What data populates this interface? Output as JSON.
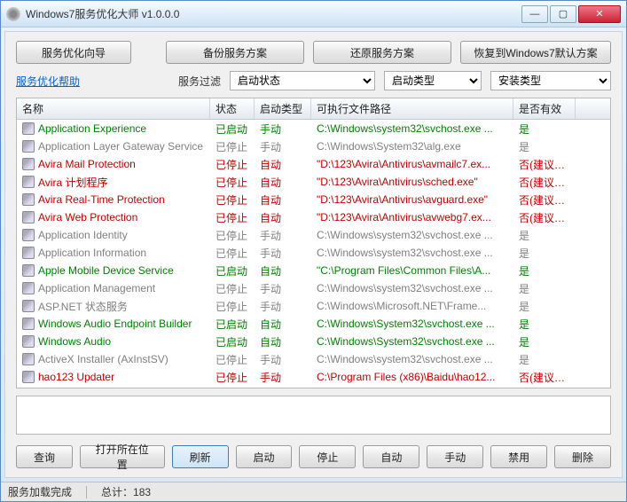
{
  "title": "Windows7服务优化大师 v1.0.0.0",
  "topButtons": {
    "wizard": "服务优化向导",
    "backup": "备份服务方案",
    "restore": "还原服务方案",
    "resetDefault": "恢复到Windows7默认方案"
  },
  "helpLink": "服务优化帮助",
  "filterLabel": "服务过滤",
  "filters": {
    "state": {
      "selected": "启动状态",
      "options": [
        "启动状态"
      ]
    },
    "startType": {
      "selected": "启动类型",
      "options": [
        "启动类型"
      ]
    },
    "installType": {
      "selected": "安装类型",
      "options": [
        "安装类型"
      ]
    }
  },
  "columns": {
    "name": "名称",
    "state": "状态",
    "startType": "启动类型",
    "path": "可执行文件路径",
    "valid": "是否有效"
  },
  "rows": [
    {
      "name": "Application Experience",
      "state": "已启动",
      "start": "手动",
      "path": "C:\\Windows\\system32\\svchost.exe ...",
      "valid": "是",
      "color": "green"
    },
    {
      "name": "Application Layer Gateway Service",
      "state": "已停止",
      "start": "手动",
      "path": "C:\\Windows\\System32\\alg.exe",
      "valid": "是",
      "color": "gray"
    },
    {
      "name": "Avira Mail Protection",
      "state": "已停止",
      "start": "自动",
      "path": "\"D:\\123\\Avira\\Antivirus\\avmailc7.ex...",
      "valid": "否(建议删...",
      "color": "red"
    },
    {
      "name": "Avira 计划程序",
      "state": "已停止",
      "start": "自动",
      "path": "\"D:\\123\\Avira\\Antivirus\\sched.exe\"",
      "valid": "否(建议删...",
      "color": "red"
    },
    {
      "name": "Avira Real-Time Protection",
      "state": "已停止",
      "start": "自动",
      "path": "\"D:\\123\\Avira\\Antivirus\\avguard.exe\"",
      "valid": "否(建议删...",
      "color": "red"
    },
    {
      "name": "Avira Web Protection",
      "state": "已停止",
      "start": "自动",
      "path": "\"D:\\123\\Avira\\Antivirus\\avwebg7.ex...",
      "valid": "否(建议删...",
      "color": "red"
    },
    {
      "name": "Application Identity",
      "state": "已停止",
      "start": "手动",
      "path": "C:\\Windows\\system32\\svchost.exe ...",
      "valid": "是",
      "color": "gray"
    },
    {
      "name": "Application Information",
      "state": "已停止",
      "start": "手动",
      "path": "C:\\Windows\\system32\\svchost.exe ...",
      "valid": "是",
      "color": "gray"
    },
    {
      "name": "Apple Mobile Device Service",
      "state": "已启动",
      "start": "自动",
      "path": "\"C:\\Program Files\\Common Files\\A...",
      "valid": "是",
      "color": "green"
    },
    {
      "name": "Application Management",
      "state": "已停止",
      "start": "手动",
      "path": "C:\\Windows\\system32\\svchost.exe ...",
      "valid": "是",
      "color": "gray"
    },
    {
      "name": "ASP.NET 状态服务",
      "state": "已停止",
      "start": "手动",
      "path": "C:\\Windows\\Microsoft.NET\\Frame...",
      "valid": "是",
      "color": "gray"
    },
    {
      "name": "Windows Audio Endpoint Builder",
      "state": "已启动",
      "start": "自动",
      "path": "C:\\Windows\\System32\\svchost.exe ...",
      "valid": "是",
      "color": "green"
    },
    {
      "name": "Windows Audio",
      "state": "已启动",
      "start": "自动",
      "path": "C:\\Windows\\System32\\svchost.exe ...",
      "valid": "是",
      "color": "green"
    },
    {
      "name": "ActiveX Installer (AxInstSV)",
      "state": "已停止",
      "start": "手动",
      "path": "C:\\Windows\\system32\\svchost.exe ...",
      "valid": "是",
      "color": "gray"
    },
    {
      "name": "hao123 Updater",
      "state": "已停止",
      "start": "手动",
      "path": "C:\\Program Files (x86)\\Baidu\\hao12...",
      "valid": "否(建议删...",
      "color": "red"
    }
  ],
  "bottomButtons": {
    "query": "查询",
    "openLoc": "打开所在位置",
    "refresh": "刷新",
    "start": "启动",
    "stop": "停止",
    "auto": "自动",
    "manual": "手动",
    "disable": "禁用",
    "delete": "删除"
  },
  "status": {
    "loaded": "服务加载完成",
    "totalLabel": "总计：",
    "total": "183"
  }
}
